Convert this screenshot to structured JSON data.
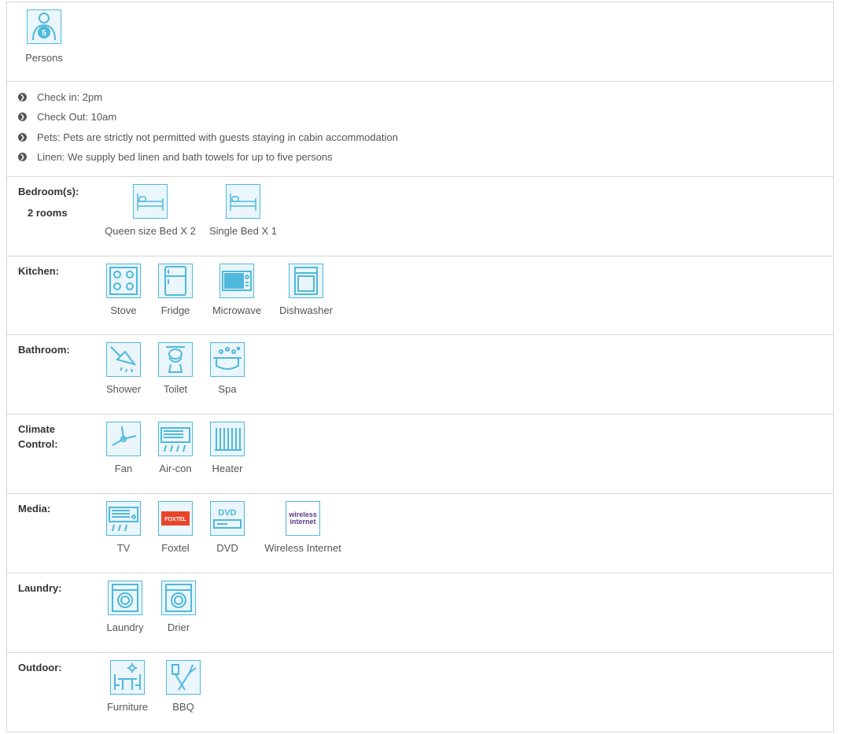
{
  "persons": {
    "count": "5",
    "label": "Persons"
  },
  "details": [
    "Check in: 2pm",
    "Check Out: 10am",
    "Pets: Pets are strictly not permitted with guests staying in cabin accommodation",
    "Linen: We supply bed linen and bath towels for up to five persons"
  ],
  "bedrooms": {
    "label": "Bedroom(s):",
    "rooms": "2 rooms",
    "items": [
      {
        "label": "Queen size Bed X 2",
        "icon": "bed-icon"
      },
      {
        "label": "Single Bed X 1",
        "icon": "bed-icon"
      }
    ]
  },
  "kitchen": {
    "label": "Kitchen:",
    "items": [
      {
        "label": "Stove",
        "icon": "stove-icon"
      },
      {
        "label": "Fridge",
        "icon": "fridge-icon"
      },
      {
        "label": "Microwave",
        "icon": "microwave-icon"
      },
      {
        "label": "Dishwasher",
        "icon": "dishwasher-icon"
      }
    ]
  },
  "bathroom": {
    "label": "Bathroom:",
    "items": [
      {
        "label": "Shower",
        "icon": "shower-icon"
      },
      {
        "label": "Toilet",
        "icon": "toilet-icon"
      },
      {
        "label": "Spa",
        "icon": "spa-icon"
      }
    ]
  },
  "climate": {
    "label_line1": "Climate",
    "label_line2": "Control:",
    "items": [
      {
        "label": "Fan",
        "icon": "fan-icon"
      },
      {
        "label": "Air-con",
        "icon": "aircon-icon"
      },
      {
        "label": "Heater",
        "icon": "heater-icon"
      }
    ]
  },
  "media": {
    "label": "Media:",
    "items": [
      {
        "label": "TV",
        "icon": "tv-icon"
      },
      {
        "label": "Foxtel",
        "icon": "foxtel-icon"
      },
      {
        "label": "DVD",
        "icon": "dvd-icon"
      },
      {
        "label": "Wireless Internet",
        "icon": "wifi-icon"
      }
    ],
    "foxtel_logo_text": "FOXTEL",
    "dvd_logo_text": "DVD",
    "wifi_logo_line1": "wireless",
    "wifi_logo_line2": "internet"
  },
  "laundry": {
    "label": "Laundry:",
    "items": [
      {
        "label": "Laundry",
        "icon": "washing-machine-icon"
      },
      {
        "label": "Drier",
        "icon": "dryer-icon"
      }
    ]
  },
  "outdoor": {
    "label": "Outdoor:",
    "items": [
      {
        "label": "Furniture",
        "icon": "outdoor-furniture-icon"
      },
      {
        "label": "BBQ",
        "icon": "bbq-icon"
      }
    ]
  },
  "colors": {
    "icon_stroke": "#4fb8dc",
    "icon_fill": "#eaf6fb",
    "border": "#d6d6d6",
    "text": "#555555",
    "heading": "#333333",
    "foxtel": "#e8442a",
    "wifi": "#5b3a8c"
  }
}
